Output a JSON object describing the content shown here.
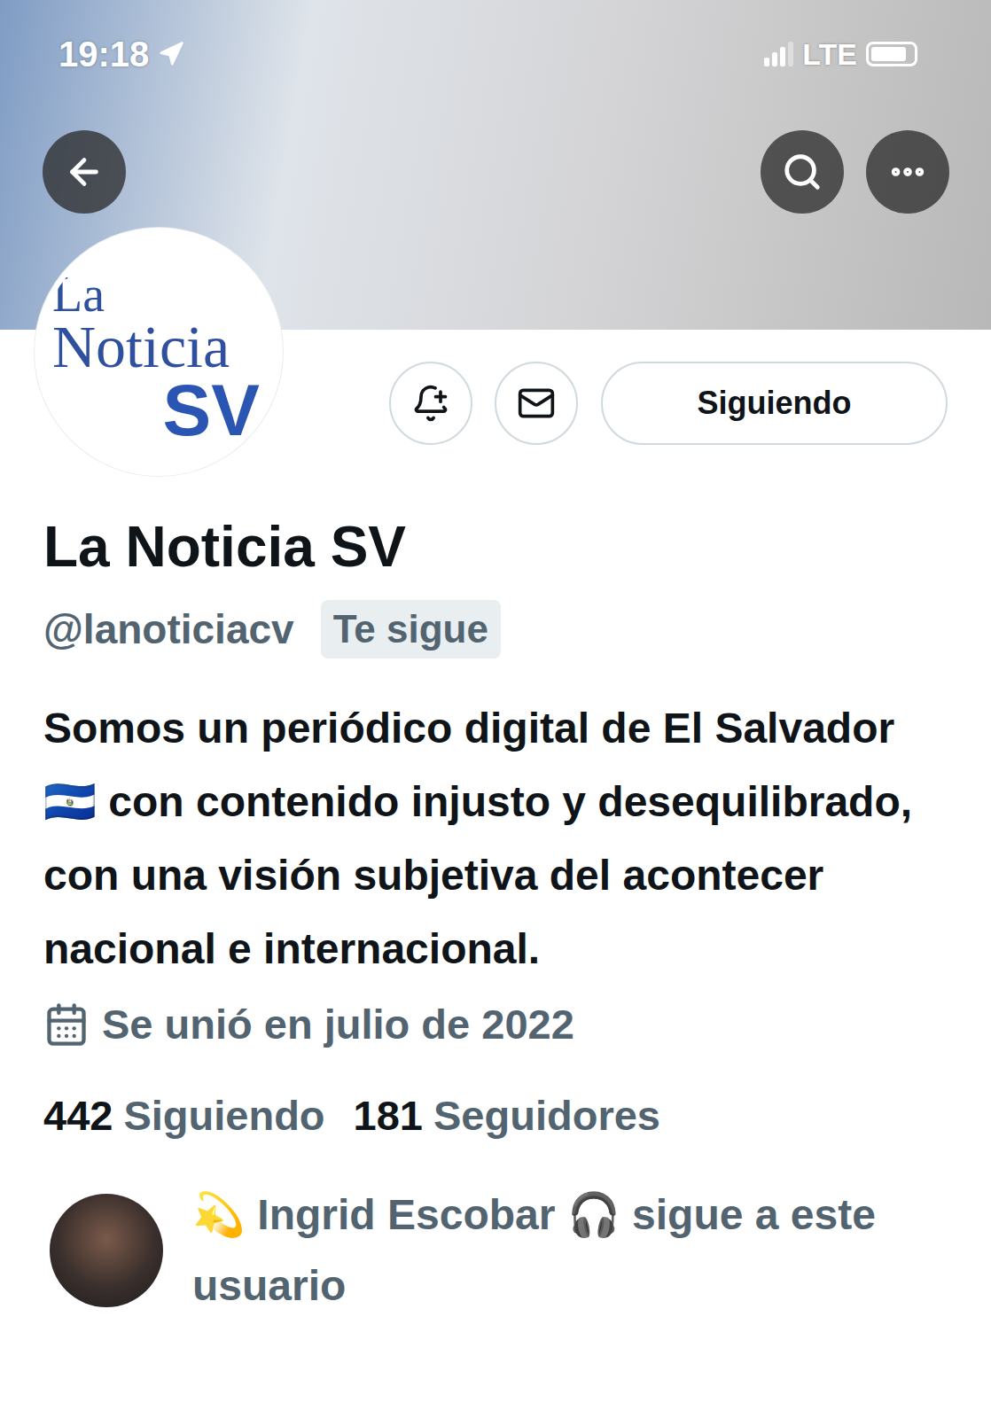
{
  "status_bar": {
    "time": "19:18",
    "network": "LTE",
    "signal_level": 0.75,
    "battery_level": 0.85
  },
  "profile": {
    "avatar_logo": {
      "line1": "La",
      "line2": "Noticia",
      "line3": "SV"
    },
    "name": "La Noticia SV",
    "handle": "@lanoticiacv",
    "follows_you_badge": "Te sigue",
    "bio": "Somos un periódico digital de El Salvador 🇸🇻 con contenido injusto y desequilibrado, con una visión subjetiva del acontecer nacional e internacional.",
    "joined": "Se unió en julio de 2022",
    "following": true,
    "follow_button": "Siguiendo"
  },
  "stats": [
    {
      "count": "442",
      "label": "Siguiendo"
    },
    {
      "count": "181",
      "label": "Seguidores"
    }
  ],
  "followed_by": {
    "text": "💫 Ingrid Escobar 🎧 sigue a este usuario"
  }
}
